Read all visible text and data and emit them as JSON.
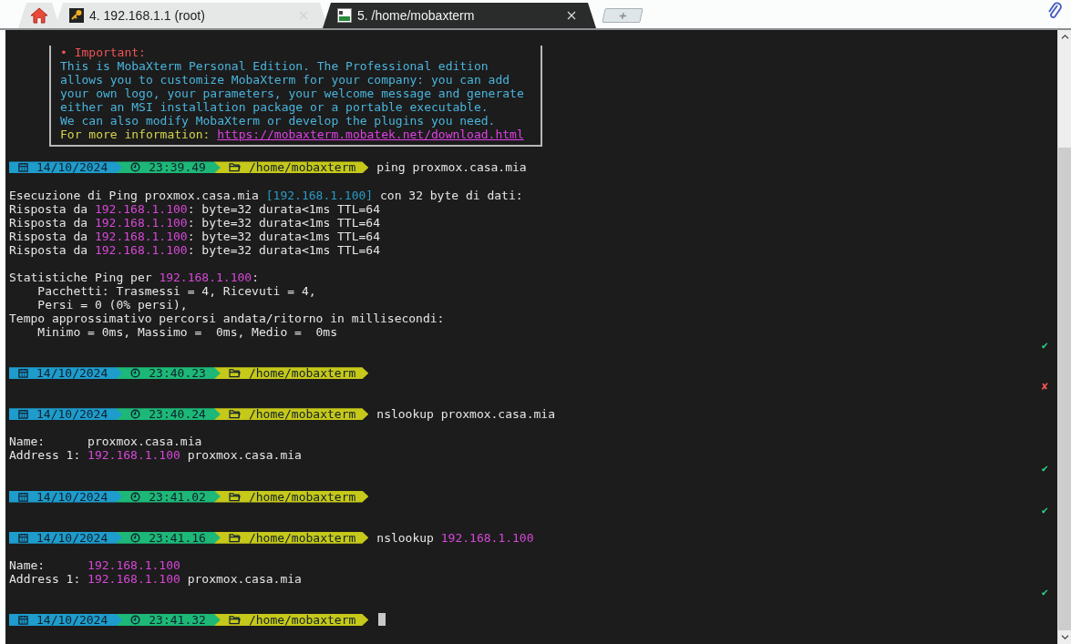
{
  "tabs": [
    {
      "kind": "home",
      "selected": false
    },
    {
      "kind": "ssh",
      "label": "4. 192.168.1.1 (root)",
      "selected": false
    },
    {
      "kind": "shell",
      "label": "5. /home/mobaxterm",
      "selected": true
    }
  ],
  "terminal": {
    "lines": [
      {
        "kind": "blank"
      },
      {
        "kind": "box",
        "heading": "• Important:",
        "body": [
          "This is MobaXterm Personal Edition. The Professional edition",
          "allows you to customize MobaXterm for your company: you can add",
          "your own logo, your parameters, your welcome message and generate",
          "either an MSI installation package or a portable executable.",
          "We can also modify MobaXterm or develop the plugins you need."
        ],
        "info_label": "For more information: ",
        "link": "https://mobaxterm.mobatek.net/download.html"
      },
      {
        "kind": "blank"
      },
      {
        "kind": "prompt",
        "date": "14/10/2024",
        "time": "23:39.49",
        "path": "/home/mobaxterm",
        "command": [
          {
            "kind": "plain",
            "text": "ping proxmox.casa.mia"
          }
        ]
      },
      {
        "kind": "blank"
      },
      {
        "kind": "text",
        "parts": [
          {
            "kind": "plain",
            "text": "Esecuzione di Ping proxmox.casa.mia "
          },
          {
            "kind": "bracket",
            "text": "[192.168.1.100]"
          },
          {
            "kind": "plain",
            "text": " con 32 byte di dati:"
          }
        ]
      },
      {
        "kind": "text",
        "parts": [
          {
            "kind": "plain",
            "text": "Risposta da "
          },
          {
            "kind": "ip",
            "text": "192.168.1.100"
          },
          {
            "kind": "plain",
            "text": ": byte=32 durata<1ms TTL=64"
          }
        ]
      },
      {
        "kind": "text",
        "parts": [
          {
            "kind": "plain",
            "text": "Risposta da "
          },
          {
            "kind": "ip",
            "text": "192.168.1.100"
          },
          {
            "kind": "plain",
            "text": ": byte=32 durata<1ms TTL=64"
          }
        ]
      },
      {
        "kind": "text",
        "parts": [
          {
            "kind": "plain",
            "text": "Risposta da "
          },
          {
            "kind": "ip",
            "text": "192.168.1.100"
          },
          {
            "kind": "plain",
            "text": ": byte=32 durata<1ms TTL=64"
          }
        ]
      },
      {
        "kind": "text",
        "parts": [
          {
            "kind": "plain",
            "text": "Risposta da "
          },
          {
            "kind": "ip",
            "text": "192.168.1.100"
          },
          {
            "kind": "plain",
            "text": ": byte=32 durata<1ms TTL=64"
          }
        ]
      },
      {
        "kind": "blank"
      },
      {
        "kind": "text",
        "parts": [
          {
            "kind": "plain",
            "text": "Statistiche Ping per "
          },
          {
            "kind": "ip",
            "text": "192.168.1.100"
          },
          {
            "kind": "plain",
            "text": ":"
          }
        ]
      },
      {
        "kind": "text",
        "parts": [
          {
            "kind": "plain",
            "text": "    Pacchetti: Trasmessi = 4, Ricevuti = 4,"
          }
        ]
      },
      {
        "kind": "text",
        "parts": [
          {
            "kind": "plain",
            "text": "    Persi = 0 (0% persi),"
          }
        ]
      },
      {
        "kind": "text",
        "parts": [
          {
            "kind": "plain",
            "text": "Tempo approssimativo percorsi andata/ritorno in millisecondi:"
          }
        ]
      },
      {
        "kind": "text",
        "parts": [
          {
            "kind": "plain",
            "text": "    Minimo = 0ms, Massimo =  0ms, Medio =  0ms"
          }
        ]
      },
      {
        "kind": "ok",
        "mark": "✔"
      },
      {
        "kind": "blank"
      },
      {
        "kind": "prompt",
        "date": "14/10/2024",
        "time": "23:40.23",
        "path": "/home/mobaxterm"
      },
      {
        "kind": "fail",
        "mark": "✘"
      },
      {
        "kind": "blank"
      },
      {
        "kind": "prompt",
        "date": "14/10/2024",
        "time": "23:40.24",
        "path": "/home/mobaxterm",
        "command": [
          {
            "kind": "plain",
            "text": "nslookup proxmox.casa.mia"
          }
        ]
      },
      {
        "kind": "blank"
      },
      {
        "kind": "text",
        "parts": [
          {
            "kind": "plain",
            "text": "Name:      proxmox.casa.mia"
          }
        ]
      },
      {
        "kind": "text",
        "parts": [
          {
            "kind": "plain",
            "text": "Address 1: "
          },
          {
            "kind": "ip",
            "text": "192.168.1.100"
          },
          {
            "kind": "plain",
            "text": " proxmox.casa.mia"
          }
        ]
      },
      {
        "kind": "ok",
        "mark": "✔"
      },
      {
        "kind": "blank"
      },
      {
        "kind": "prompt",
        "date": "14/10/2024",
        "time": "23:41.02",
        "path": "/home/mobaxterm"
      },
      {
        "kind": "ok",
        "mark": "✔"
      },
      {
        "kind": "blank"
      },
      {
        "kind": "prompt",
        "date": "14/10/2024",
        "time": "23:41.16",
        "path": "/home/mobaxterm",
        "command": [
          {
            "kind": "plain",
            "text": "nslookup "
          },
          {
            "kind": "ip",
            "text": "192.168.1.100"
          }
        ]
      },
      {
        "kind": "blank"
      },
      {
        "kind": "text",
        "parts": [
          {
            "kind": "plain",
            "text": "Name:      "
          },
          {
            "kind": "ip",
            "text": "192.168.1.100"
          }
        ]
      },
      {
        "kind": "text",
        "parts": [
          {
            "kind": "plain",
            "text": "Address 1: "
          },
          {
            "kind": "ip",
            "text": "192.168.1.100"
          },
          {
            "kind": "plain",
            "text": " proxmox.casa.mia"
          }
        ]
      },
      {
        "kind": "ok",
        "mark": "✔"
      },
      {
        "kind": "blank"
      },
      {
        "kind": "prompt",
        "date": "14/10/2024",
        "time": "23:41.32",
        "path": "/home/mobaxterm",
        "cursor": true
      }
    ]
  }
}
